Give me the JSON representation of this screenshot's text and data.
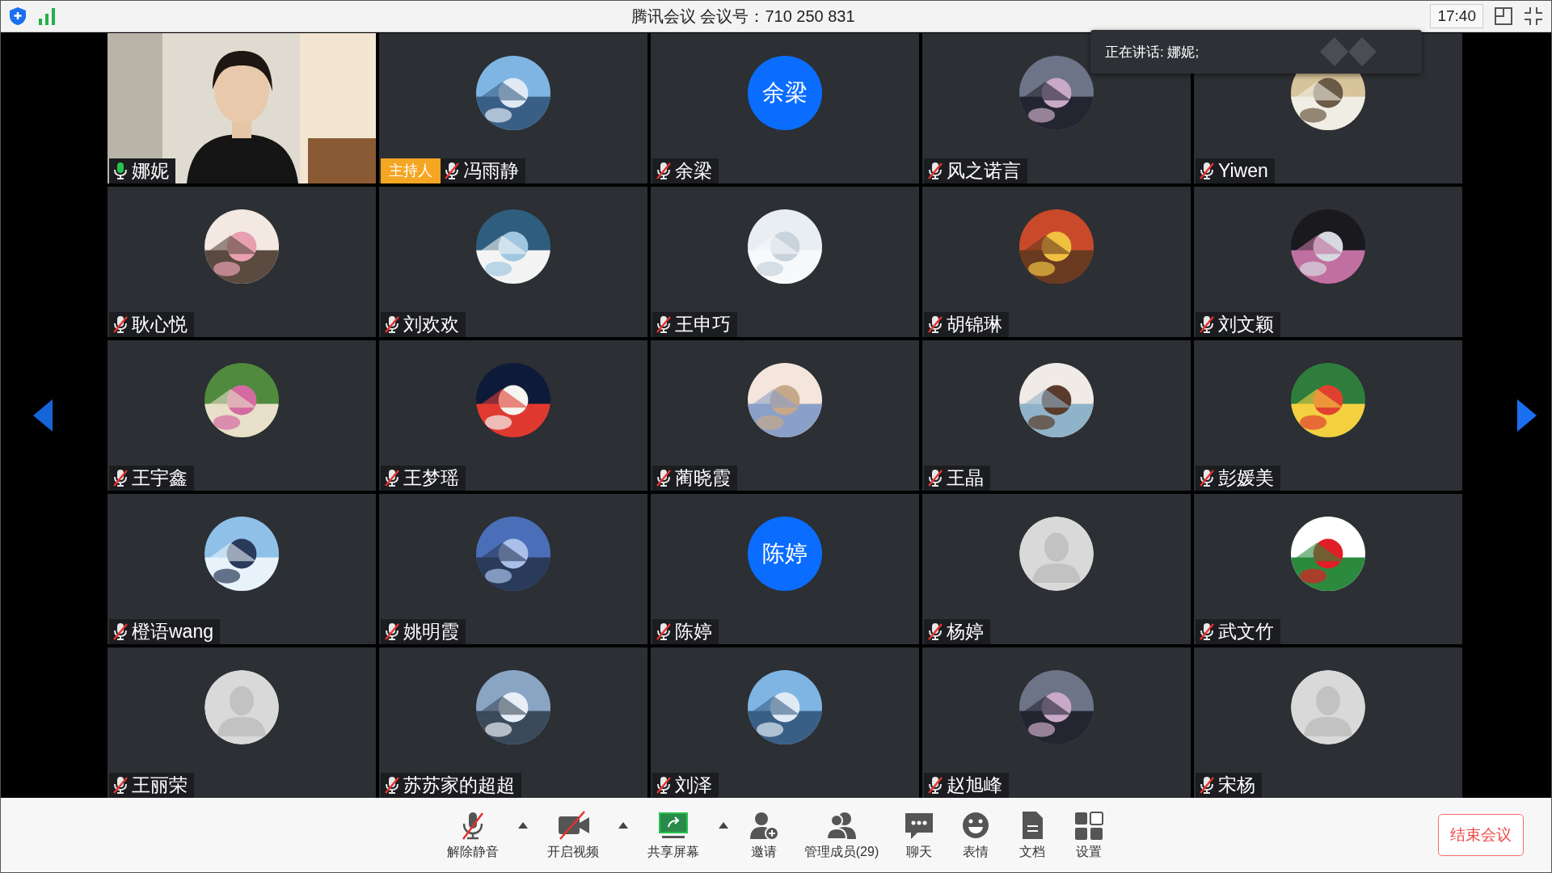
{
  "top_bar": {
    "title": "腾讯会议 会议号：710 250 831",
    "time": "17:40"
  },
  "speaking_notice": "正在讲话: 娜妮;",
  "participants": [
    {
      "name": "娜妮",
      "muted": false,
      "avatar": {
        "kind": "video"
      }
    },
    {
      "name": "冯雨静",
      "muted": true,
      "badge": "主持人"
    },
    {
      "name": "余梁",
      "muted": true,
      "avatar": {
        "kind": "initials",
        "text": "余梁"
      }
    },
    {
      "name": "风之诺言",
      "muted": true
    },
    {
      "name": "Yiwen",
      "muted": true
    },
    {
      "name": "耿心悦",
      "muted": true
    },
    {
      "name": "刘欢欢",
      "muted": true
    },
    {
      "name": "王申巧",
      "muted": true
    },
    {
      "name": "胡锦琳",
      "muted": true
    },
    {
      "name": "刘文颖",
      "muted": true
    },
    {
      "name": "王宇鑫",
      "muted": true
    },
    {
      "name": "王梦瑶",
      "muted": true
    },
    {
      "name": "蔺晓霞",
      "muted": true
    },
    {
      "name": "王晶",
      "muted": true
    },
    {
      "name": "彭媛美",
      "muted": true
    },
    {
      "name": "橙语wang",
      "muted": true
    },
    {
      "name": "姚明霞",
      "muted": true
    },
    {
      "name": "陈婷",
      "muted": true,
      "avatar": {
        "kind": "initials",
        "text": "陈婷"
      }
    },
    {
      "name": "杨婷",
      "muted": true,
      "avatar": {
        "kind": "default"
      }
    },
    {
      "name": "武文竹",
      "muted": true
    },
    {
      "name": "王丽荣",
      "muted": true,
      "avatar": {
        "kind": "default"
      }
    },
    {
      "name": "苏苏家的超超",
      "muted": true
    },
    {
      "name": "刘泽",
      "muted": true
    },
    {
      "name": "赵旭峰",
      "muted": true
    },
    {
      "name": "宋杨",
      "muted": true,
      "avatar": {
        "kind": "default"
      }
    }
  ],
  "toolbar": [
    {
      "kind": "mic",
      "label": "解除静音",
      "off": true,
      "menu": true
    },
    {
      "kind": "video",
      "label": "开启视频",
      "off": true,
      "menu": true
    },
    {
      "kind": "share",
      "label": "共享屏幕",
      "menu": true
    },
    {
      "kind": "invite",
      "label": "邀请",
      "menu": false
    },
    {
      "kind": "members",
      "label": "管理成员(29)",
      "menu": false
    },
    {
      "kind": "chat",
      "label": "聊天",
      "menu": false
    },
    {
      "kind": "emoji",
      "label": "表情",
      "menu": false
    },
    {
      "kind": "doc",
      "label": "文档",
      "menu": false
    },
    {
      "kind": "settings",
      "label": "设置",
      "menu": false
    }
  ],
  "end_button": "结束会议"
}
